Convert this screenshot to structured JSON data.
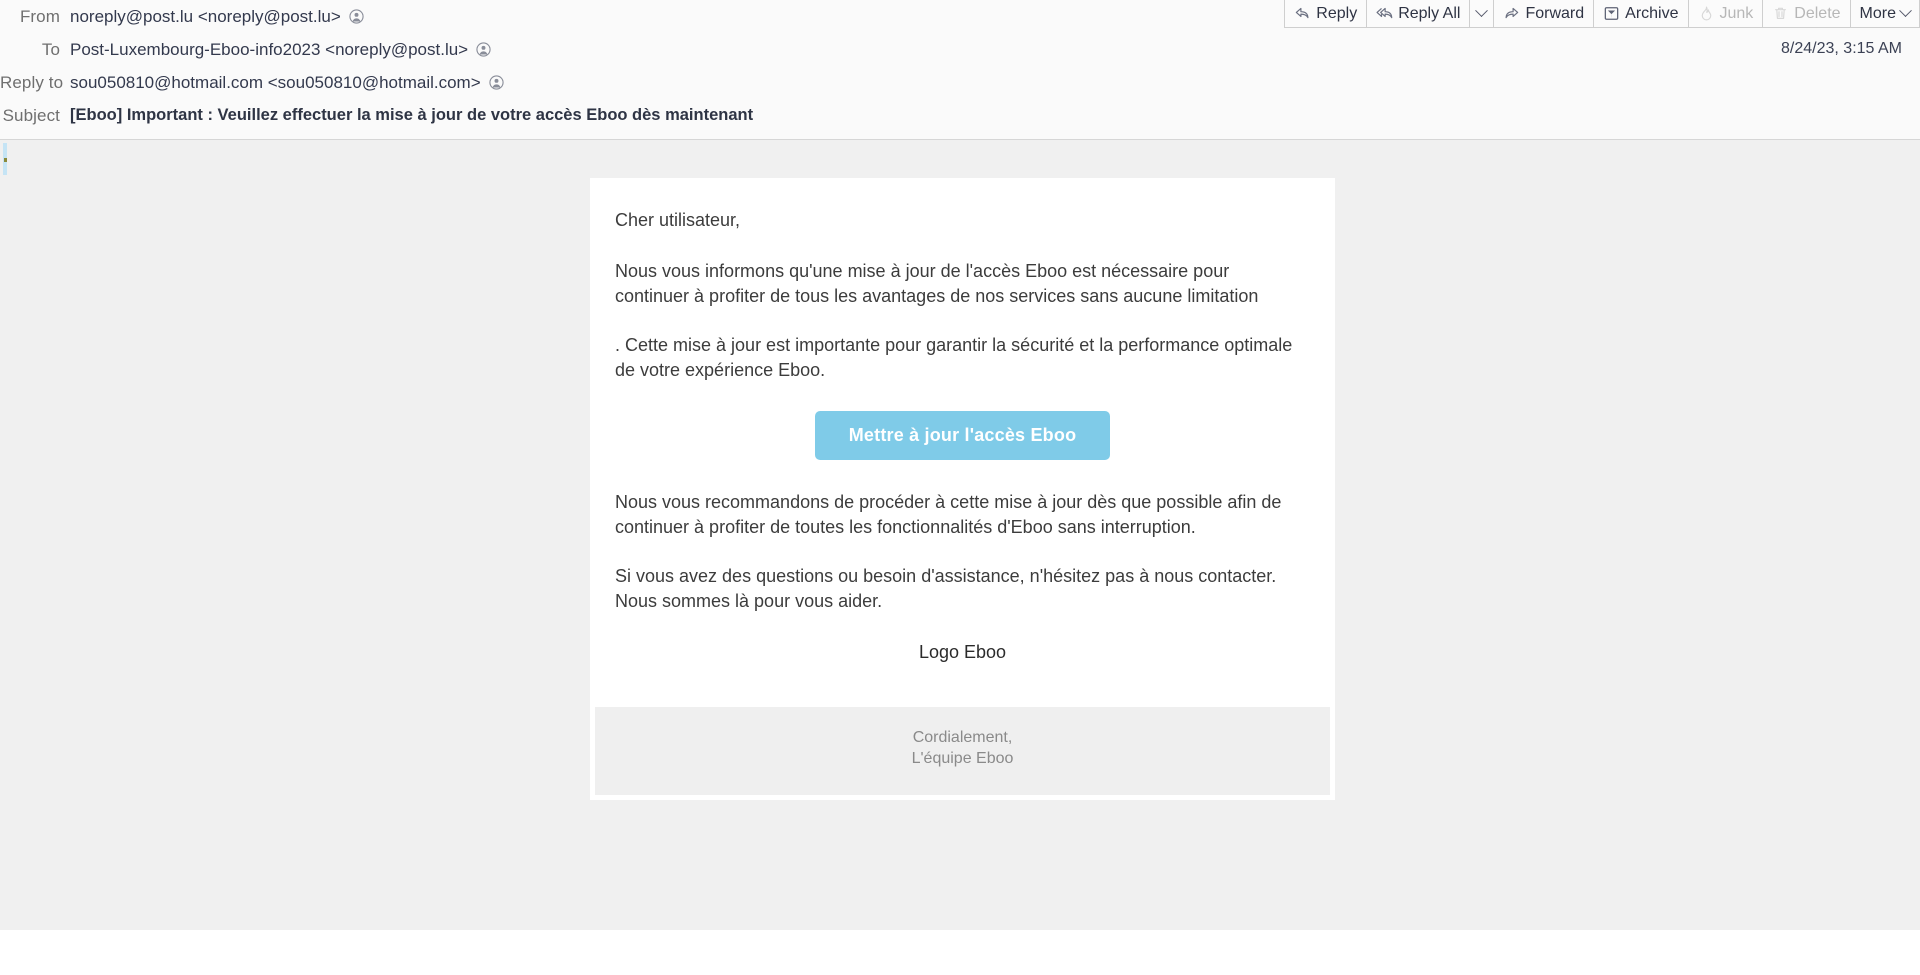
{
  "toolbar": {
    "buttons": [
      {
        "label": "Reply",
        "icon": "reply-icon",
        "disabled": false,
        "caret": false
      },
      {
        "label": "Reply All",
        "icon": "reply-all-icon",
        "disabled": false,
        "caret": false
      },
      {
        "label": "",
        "icon": "",
        "disabled": false,
        "caret": true
      },
      {
        "label": "Forward",
        "icon": "forward-icon",
        "disabled": false,
        "caret": false
      },
      {
        "label": "Archive",
        "icon": "archive-icon",
        "disabled": false,
        "caret": false
      },
      {
        "label": "Junk",
        "icon": "junk-flame-icon",
        "disabled": true,
        "caret": false
      },
      {
        "label": "Delete",
        "icon": "trash-icon",
        "disabled": true,
        "caret": false
      },
      {
        "label": "More",
        "icon": "",
        "disabled": false,
        "caret": true
      }
    ]
  },
  "header": {
    "from_label": "From",
    "from_value": "noreply@post.lu <noreply@post.lu>",
    "to_label": "To",
    "to_value": "Post-Luxembourg-Eboo-info2023 <noreply@post.lu>",
    "reply_to_label": "Reply to",
    "reply_to_value": "sou050810@hotmail.com <sou050810@hotmail.com>",
    "subject_label": "Subject",
    "subject_value": "[Eboo] Important : Veuillez effectuer la mise à jour de votre accès Eboo dès maintenant",
    "timestamp": "8/24/23, 3:15 AM"
  },
  "email": {
    "greeting": "Cher utilisateur,",
    "paragraph_1": "Nous vous informons qu'une mise à jour de l'accès Eboo est nécessaire pour continuer à profiter de tous les avantages de nos services sans aucune limitation",
    "paragraph_2": ". Cette mise à jour est importante pour garantir la sécurité et la performance optimale de votre expérience Eboo.",
    "cta_label": "Mettre à jour l'accès Eboo",
    "paragraph_3": "Nous vous recommandons de procéder à cette mise à jour dès que possible afin de continuer à profiter de toutes les fonctionnalités d'Eboo sans interruption.",
    "paragraph_4": "Si vous avez des questions ou besoin d'assistance, n'hésitez pas à nous contacter. Nous sommes là pour vous aider.",
    "logo_text": "Logo Eboo",
    "footer_line_1": "Cordialement,",
    "footer_line_2": "L'équipe Eboo"
  },
  "colors": {
    "cta_background": "#7fcbe8",
    "content_background": "#f0f0f0",
    "card_background": "#ffffff",
    "footer_background": "#efefef",
    "header_background": "#fafafa"
  }
}
